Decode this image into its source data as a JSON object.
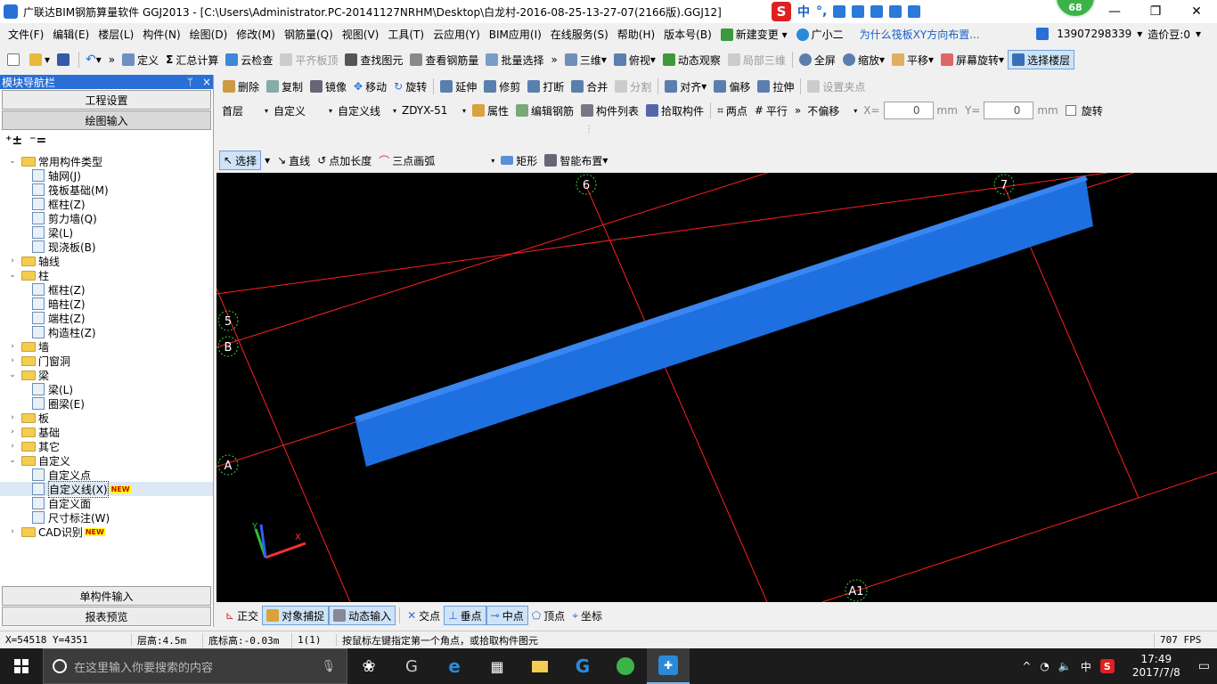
{
  "window": {
    "title": "广联达BIM钢筋算量软件 GGJ2013 - [C:\\Users\\Administrator.PC-20141127NRHM\\Desktop\\白龙村-2016-08-25-13-27-07(2166版).GGJ12]",
    "badge": "68",
    "ime": {
      "s": "S",
      "lang": "中",
      "punct": "°,"
    }
  },
  "menu": {
    "items": [
      "文件(F)",
      "编辑(E)",
      "楼层(L)",
      "构件(N)",
      "绘图(D)",
      "修改(M)",
      "钢筋量(Q)",
      "视图(V)",
      "工具(T)",
      "云应用(Y)",
      "BIM应用(I)",
      "在线服务(S)",
      "帮助(H)",
      "版本号(B)"
    ],
    "new_change": "新建变更",
    "assistant": "广小二",
    "question": "为什么筏板XY方向布置...",
    "phone": "13907298339",
    "price": "造价豆:0"
  },
  "toolbar1": {
    "define": "定义",
    "sum_calc": "汇总计算",
    "cloud_check": "云检查",
    "flat_slab_top": "平齐板顶",
    "find_element": "查找图元",
    "view_rebar": "查看钢筋量",
    "batch_select": "批量选择",
    "view3d": "三维",
    "top_view": "俯视",
    "dynamic_observe": "动态观察",
    "local3d": "局部三维",
    "fullscreen": "全屏",
    "zoom": "缩放",
    "pan": "平移",
    "screen_rotate": "屏幕旋转",
    "select_floor": "选择楼层"
  },
  "panel": {
    "title": "模块导航栏",
    "pin": "ᛘ",
    "close": "×",
    "btn_project_settings": "工程设置",
    "btn_draw_input": "绘图输入",
    "btn_single_input": "单构件输入",
    "btn_report_preview": "报表预览"
  },
  "edit_toolbar": {
    "delete": "删除",
    "copy": "复制",
    "mirror": "镜像",
    "move": "移动",
    "rotate": "旋转",
    "extend": "延伸",
    "trim": "修剪",
    "break": "打断",
    "merge": "合并",
    "split": "分割",
    "align": "对齐",
    "offset": "偏移",
    "stretch": "拉伸",
    "set_grip": "设置夹点"
  },
  "prop_toolbar": {
    "floor": "首层",
    "category": "自定义",
    "type": "自定义线",
    "name": "ZDYX-51",
    "attribute": "属性",
    "edit_rebar": "编辑钢筋",
    "component_list": "构件列表",
    "pick_component": "拾取构件",
    "two_points": "两点",
    "parallel": "平行",
    "offset_mode": "不偏移",
    "x_label": "X=",
    "x_value": "0",
    "y_label": "Y=",
    "y_value": "0",
    "unit": "mm",
    "rotate": "旋转"
  },
  "draw_toolbar": {
    "select": "选择",
    "line": "直线",
    "point_length": "点加长度",
    "three_point_arc": "三点画弧",
    "rectangle": "矩形",
    "smart_layout": "智能布置"
  },
  "tree": [
    {
      "level": 0,
      "type": "folder",
      "expanded": true,
      "label": "常用构件类型"
    },
    {
      "level": 1,
      "type": "leaf",
      "label": "轴网(J)"
    },
    {
      "level": 1,
      "type": "leaf",
      "label": "筏板基础(M)"
    },
    {
      "level": 1,
      "type": "leaf",
      "label": "框柱(Z)"
    },
    {
      "level": 1,
      "type": "leaf",
      "label": "剪力墙(Q)"
    },
    {
      "level": 1,
      "type": "leaf",
      "label": "梁(L)"
    },
    {
      "level": 1,
      "type": "leaf",
      "label": "现浇板(B)"
    },
    {
      "level": 0,
      "type": "folder",
      "expanded": false,
      "label": "轴线"
    },
    {
      "level": 0,
      "type": "folder",
      "expanded": true,
      "label": "柱"
    },
    {
      "level": 1,
      "type": "leaf",
      "label": "框柱(Z)"
    },
    {
      "level": 1,
      "type": "leaf",
      "label": "暗柱(Z)"
    },
    {
      "level": 1,
      "type": "leaf",
      "label": "端柱(Z)"
    },
    {
      "level": 1,
      "type": "leaf",
      "label": "构造柱(Z)"
    },
    {
      "level": 0,
      "type": "folder",
      "expanded": false,
      "label": "墙"
    },
    {
      "level": 0,
      "type": "folder",
      "expanded": false,
      "label": "门窗洞"
    },
    {
      "level": 0,
      "type": "folder",
      "expanded": true,
      "label": "梁"
    },
    {
      "level": 1,
      "type": "leaf",
      "label": "梁(L)"
    },
    {
      "level": 1,
      "type": "leaf",
      "label": "圈梁(E)"
    },
    {
      "level": 0,
      "type": "folder",
      "expanded": false,
      "label": "板"
    },
    {
      "level": 0,
      "type": "folder",
      "expanded": false,
      "label": "基础"
    },
    {
      "level": 0,
      "type": "folder",
      "expanded": false,
      "label": "其它"
    },
    {
      "level": 0,
      "type": "folder",
      "expanded": true,
      "label": "自定义"
    },
    {
      "level": 1,
      "type": "leaf",
      "label": "自定义点"
    },
    {
      "level": 1,
      "type": "leaf",
      "label": "自定义线(X)",
      "new": "NEW",
      "selected": true
    },
    {
      "level": 1,
      "type": "leaf",
      "label": "自定义面"
    },
    {
      "level": 1,
      "type": "leaf",
      "label": "尺寸标注(W)"
    },
    {
      "level": 0,
      "type": "folder",
      "expanded": false,
      "label": "CAD识别",
      "new": "NEW"
    }
  ],
  "canvas": {
    "axes": [
      "6",
      "7",
      "5",
      "B",
      "A",
      "A1"
    ],
    "ucs": {
      "x": "X",
      "y": "Y"
    },
    "beam_color": "#1e6fe0",
    "grid_color": "#ff2020"
  },
  "snap": {
    "ortho": "正交",
    "object_snap": "对象捕捉",
    "dynamic_input": "动态输入",
    "intersection": "交点",
    "perpendicular": "垂点",
    "midpoint": "中点",
    "vertex": "顶点",
    "coordinate": "坐标"
  },
  "status": {
    "coords": "X=54518 Y=4351",
    "floor_height": "层高:4.5m",
    "bottom_elev": "底标高:-0.03m",
    "count": "1(1)",
    "hint": "按鼠标左键指定第一个角点，或拾取构件图元",
    "fps": "707 FPS"
  },
  "taskbar": {
    "search_placeholder": "在这里输入你要搜索的内容",
    "tray_lang": "中",
    "time": "17:49",
    "date": "2017/7/8"
  }
}
